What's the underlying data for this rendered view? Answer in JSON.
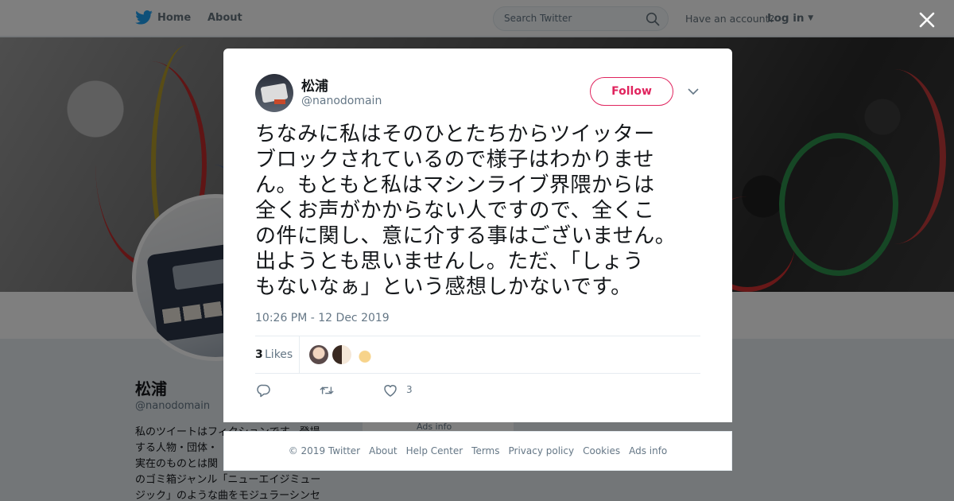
{
  "topbar": {
    "home_label": "Home",
    "about_label": "About",
    "search_placeholder": "Search Twitter",
    "account_prompt": "Have an account?",
    "login_label": "Log in"
  },
  "profile": {
    "name": "松浦",
    "handle": "@nanodomain",
    "bio_lines": [
      "私のツイートはフィクションです。登場",
      "する人物・団体・",
      "実在のものとは関",
      "のゴミ箱ジャンル「ニューエイジミュー",
      "ジック」のような曲をモジュラーシンセ"
    ],
    "ads_peek": "Ads info"
  },
  "tweet": {
    "author_name": "松浦",
    "author_handle": "@nanodomain",
    "follow_label": "Follow",
    "text_lines": [
      "ちなみに私はそのひとたちからツイッター",
      "ブロックされているので様子はわかりませ",
      "ん。もともと私はマシンライブ界隈からは",
      "全くお声がかからない人ですので、全くこ",
      "の件に関し、意に介する事はございません。",
      "出ようとも思いませんし。ただ、「しょう",
      "もないなぁ」という感想しかないです。"
    ],
    "timestamp": "10:26 PM - 12 Dec 2019",
    "likes_count": "3",
    "likes_label": "Likes",
    "like_action_count": "3"
  },
  "footer": {
    "links": [
      "© 2019 Twitter",
      "About",
      "Help Center",
      "Terms",
      "Privacy policy",
      "Cookies",
      "Ads info"
    ]
  },
  "colors": {
    "accent_follow": "#e0245e",
    "twitter_blue": "#1da1f2",
    "muted_text": "#657786"
  },
  "icons": {
    "logo": "twitter-bird-icon",
    "search": "search-icon",
    "caret": "caret-down-icon",
    "close": "close-icon",
    "reply": "reply-icon",
    "retweet": "retweet-icon",
    "like": "heart-icon"
  }
}
